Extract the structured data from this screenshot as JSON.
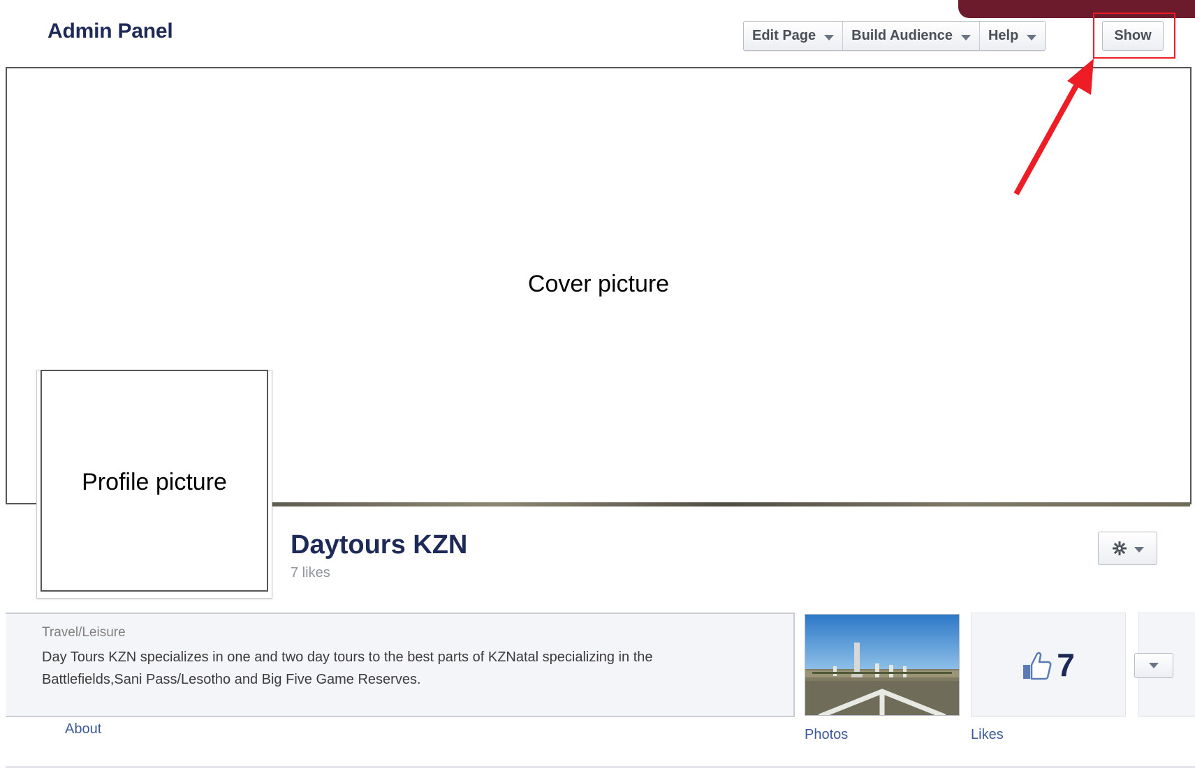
{
  "header": {
    "title": "Admin Panel",
    "buttons": [
      {
        "label": "Edit Page"
      },
      {
        "label": "Build Audience"
      },
      {
        "label": "Help"
      }
    ],
    "show_label": "Show"
  },
  "cover": {
    "label": "Cover picture"
  },
  "profile": {
    "label": "Profile picture"
  },
  "page": {
    "name": "Daytours KZN",
    "likes_text": "7 likes"
  },
  "about": {
    "category": "Travel/Leisure",
    "description": "Day Tours KZN specializes in one and two day tours to the best parts of KZNatal specializing in the Battlefields,Sani Pass/Lesotho and Big Five Game Reserves.",
    "link": "About"
  },
  "photos": {
    "link": "Photos"
  },
  "likes": {
    "count": "7",
    "link": "Likes"
  },
  "icons": {
    "dropdown": "chevron-down-icon",
    "gear": "gear-icon",
    "like": "thumbs-up-icon",
    "annotation": "red-arrow"
  },
  "colors": {
    "annotation_red": "#ee1c25",
    "brand_navy": "#1d2a57",
    "link_blue": "#3b5998",
    "top_strip_maroon": "#6b1b2c"
  }
}
